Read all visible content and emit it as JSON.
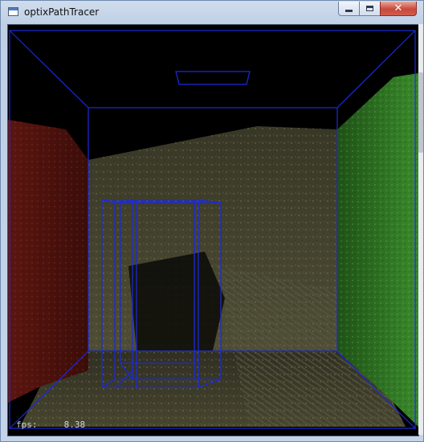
{
  "window": {
    "title": "optixPathTracer",
    "icon": "app-window-icon",
    "controls": {
      "minimize_icon": "minimize-icon",
      "maximize_icon": "maximize-icon",
      "close_icon": "close-icon",
      "close_glyph": "✕",
      "close_color": "#c8483a"
    }
  },
  "viewport": {
    "fps_label": "fps:",
    "fps_value": "8.38",
    "colors": {
      "background": "#000000",
      "wireframe": "#1a2bdc",
      "left_wall": "#6e1a14",
      "right_wall": "#2e7a24",
      "back_wall": "#4c4a32",
      "floor": "#3d3b2a"
    }
  }
}
